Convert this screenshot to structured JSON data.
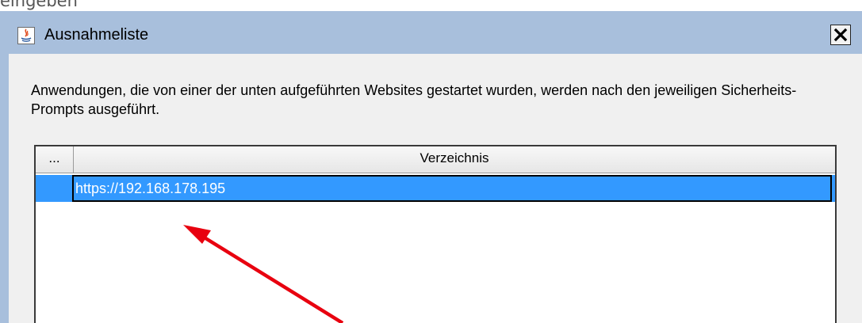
{
  "background_text": "eingeben",
  "dialog": {
    "title": "Ausnahmeliste",
    "close_label": "x",
    "description": "Anwendungen, die von einer der unten aufgeführten Websites gestartet wurden, werden nach den jeweiligen Sicherheits-Prompts ausgeführt.",
    "table": {
      "columns": [
        "...",
        "Verzeichnis"
      ],
      "rows": [
        {
          "value": "https://192.168.178.195",
          "selected": true
        }
      ]
    }
  },
  "colors": {
    "titlebar": "#a8bfdc",
    "selection": "#3399ff",
    "arrow": "#e8000f"
  }
}
